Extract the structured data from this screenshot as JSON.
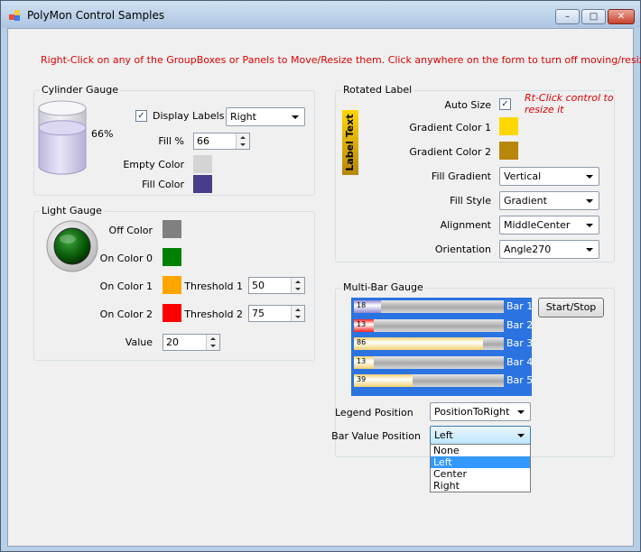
{
  "window": {
    "title": "PolyMon Control Samples"
  },
  "hint": "Right-Click on any of the GroupBoxes or Panels to Move/Resize them. Click anywhere on the form to turn off moving/resizing.",
  "cylinder": {
    "group_label": "Cylinder Gauge",
    "percent_text": "66%",
    "fill_fraction": 0.66,
    "display_labels_label": "Display Labels",
    "display_labels_checked": true,
    "label_position": "Right",
    "fill_label": "Fill %",
    "fill_value": "66",
    "empty_color_label": "Empty Color",
    "empty_color": "#d4d4d4",
    "fill_color_label": "Fill Color",
    "fill_color": "#483d8b"
  },
  "light": {
    "group_label": "Light Gauge",
    "off_color_label": "Off Color",
    "off_color": "#808080",
    "on_color0_label": "On Color 0",
    "on_color0": "#008000",
    "on_color1_label": "On Color 1",
    "on_color1": "#ffa500",
    "on_color2_label": "On Color 2",
    "on_color2": "#ff0000",
    "threshold1_label": "Threshold 1",
    "threshold1_value": "50",
    "threshold2_label": "Threshold 2",
    "threshold2_value": "75",
    "value_label": "Value",
    "value": "20"
  },
  "rotated": {
    "group_label": "Rotated Label",
    "label_text": "Label Text",
    "auto_size_label": "Auto Size",
    "auto_size_checked": true,
    "note_line1": "Rt-Click control to",
    "note_line2": "resize  it",
    "gradient1_label": "Gradient Color 1",
    "gradient1": "#ffd700",
    "gradient2_label": "Gradient Color 2",
    "gradient2": "#b8860b",
    "fill_gradient_label": "Fill Gradient",
    "fill_gradient_value": "Vertical",
    "fill_style_label": "Fill Style",
    "fill_style_value": "Gradient",
    "alignment_label": "Alignment",
    "alignment_value": "MiddleCenter",
    "orientation_label": "Orientation",
    "orientation_value": "Angle270"
  },
  "multibar": {
    "group_label": "Multi-Bar Gauge",
    "start_stop_label": "Start/Stop",
    "bars": [
      {
        "name": "Bar 1",
        "value_text": "18",
        "value": 18,
        "color": "#8f88cf"
      },
      {
        "name": "Bar 2",
        "value_text": "13",
        "value": 13,
        "color": "#ff2020"
      },
      {
        "name": "Bar 3",
        "value_text": "86",
        "value": 86,
        "color": "#f0d070"
      },
      {
        "name": "Bar 4",
        "value_text": "13",
        "value": 13,
        "color": "#f0d070"
      },
      {
        "name": "Bar 5",
        "value_text": "39",
        "value": 39,
        "color": "#f0d070"
      }
    ],
    "legend_position_label": "Legend Position",
    "legend_position_value": "PositionToRight",
    "bar_value_position_label": "Bar Value Position",
    "bar_value_position_value": "Left",
    "bar_value_options": [
      "None",
      "Left",
      "Center",
      "Right"
    ],
    "bar_value_selected_index": 1
  },
  "colors": {
    "bar_panel_bg": "#2b73e0",
    "hint_red": "#e00000",
    "selection_blue": "#3399ff"
  }
}
